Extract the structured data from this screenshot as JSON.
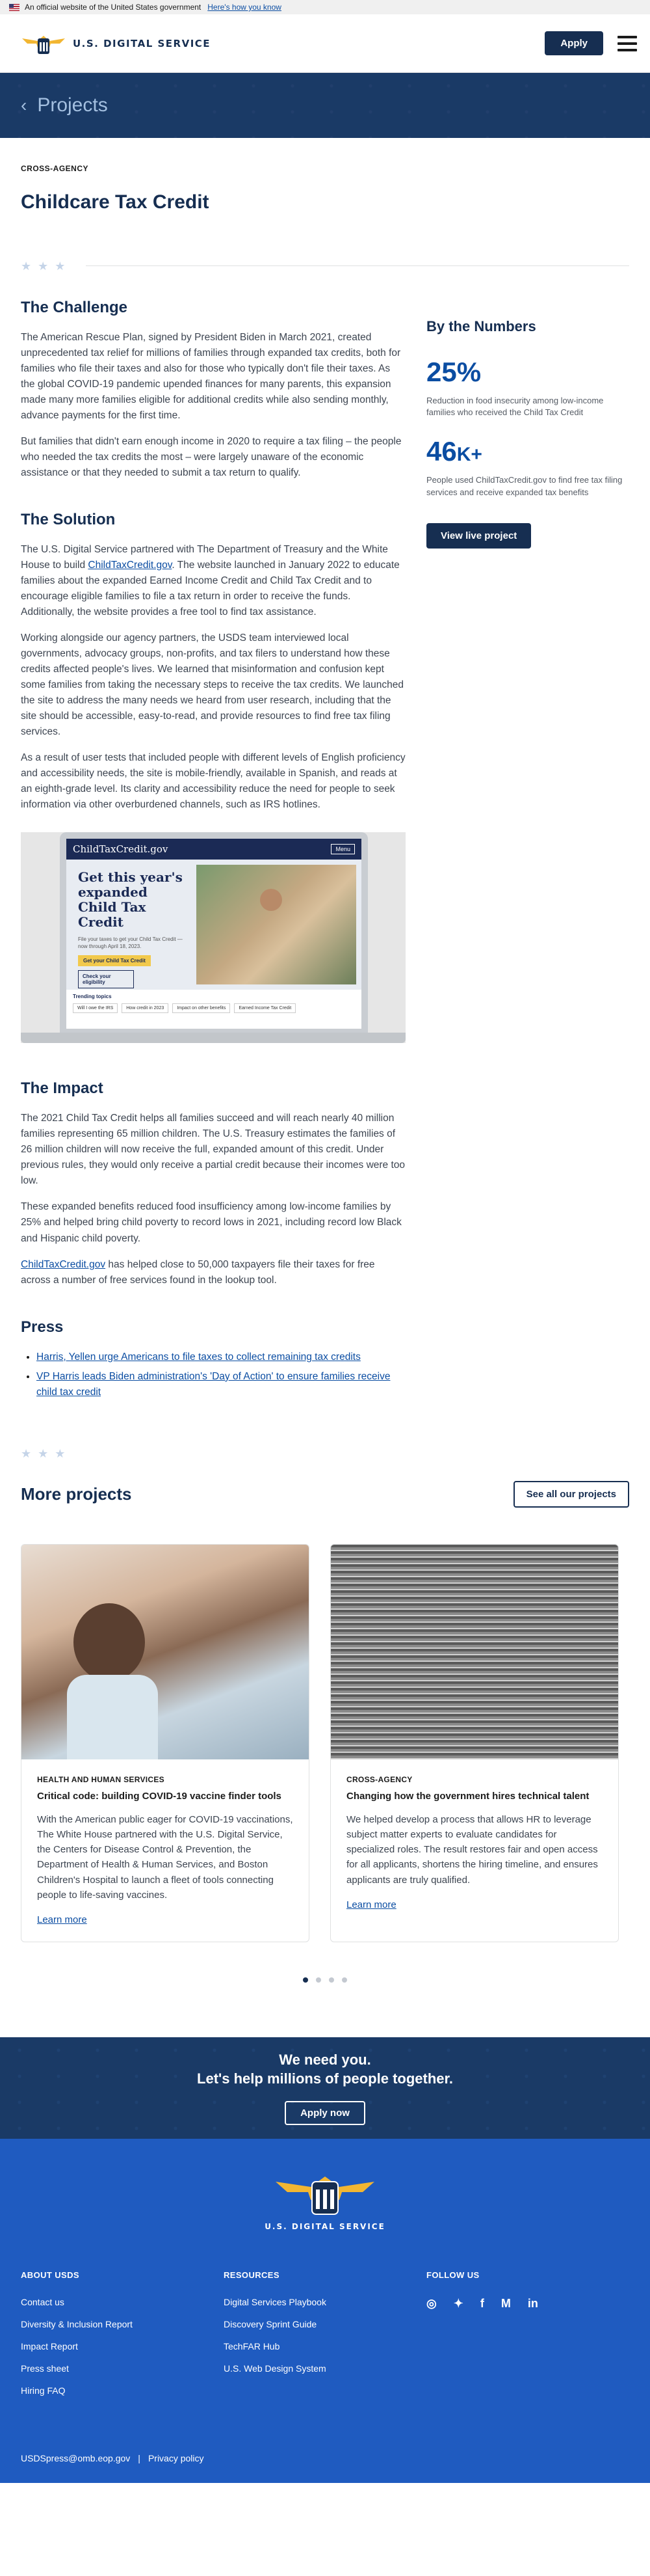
{
  "banner": {
    "text": "An official website of the United States government",
    "link": "Here's how you know"
  },
  "header": {
    "logo_text": "U.S. DIGITAL SERVICE",
    "apply_label": "Apply"
  },
  "hero": {
    "title": "Projects"
  },
  "project": {
    "tag": "CROSS-AGENCY",
    "title": "Childcare Tax Credit"
  },
  "challenge": {
    "heading": "The Challenge",
    "p1": "The American Rescue Plan, signed by President Biden in March 2021, created unprecedented tax relief for millions of families through expanded tax credits, both for families who file their taxes and also for those who typically don't file their taxes. As the global COVID-19 pandemic upended finances for many parents, this expansion made many more families eligible for additional credits while also sending monthly, advance payments for the first time.",
    "p2": "But families that didn't earn enough income in 2020 to require a tax filing – the people who needed the tax credits the most – were largely unaware of the economic assistance or that they needed to submit a tax return to qualify."
  },
  "solution": {
    "heading": "The Solution",
    "p1_before": "The U.S. Digital Service partnered with The Department of Treasury and the White House to build ",
    "p1_link": "ChildTaxCredit.gov",
    "p1_after": ". The website launched in January 2022 to educate families about the expanded Earned Income Credit and Child Tax Credit and to encourage eligible families to file a tax return in order to receive the funds. Additionally, the website provides a free tool to find tax assistance.",
    "p2": "Working alongside our agency partners, the USDS team interviewed local governments, advocacy groups, non-profits, and tax filers to understand how these credits affected people's lives. We learned that misinformation and confusion kept some families from taking the necessary steps to receive the tax credits. We launched the site to address the many needs we heard from user research, including that the site should be accessible, easy-to-read, and provide resources to find free tax filing services.",
    "p3": "As a result of user tests that included people with different levels of English proficiency and accessibility needs, the site is mobile-friendly, available in Spanish, and reads at an eighth-grade level. Its clarity and accessibility reduce the need for people to seek information via other overburdened channels, such as IRS hotlines."
  },
  "screenshot": {
    "logo": "ChildTaxCredit.gov",
    "menu": "Menu",
    "headline": "Get this year's expanded Child Tax Credit",
    "small": "File your taxes to get your Child Tax Credit — now through April 18, 2023.",
    "btn1": "Get your Child Tax Credit",
    "btn2": "Check your eligibility",
    "trending": "Trending topics",
    "chips": [
      "Will I owe the IRS",
      "How credit in 2023",
      "Impact on other benefits",
      "Earned Income Tax Credit"
    ]
  },
  "impact": {
    "heading": "The Impact",
    "p1": "The 2021 Child Tax Credit helps all families succeed and will reach nearly 40 million families representing 65 million children. The U.S. Treasury estimates the families of 26 million children will now receive the full, expanded amount of this credit. Under previous rules, they would only receive a partial credit because their incomes were too low.",
    "p2": "These expanded benefits reduced food insufficiency among low-income families by 25% and helped bring child poverty to record lows in 2021, including record low Black and Hispanic child poverty.",
    "p3_link": "ChildTaxCredit.gov",
    "p3_after": " has helped close to 50,000 taxpayers file their taxes for free across a number of free services found in the lookup tool."
  },
  "press": {
    "heading": "Press",
    "items": [
      "Harris, Yellen urge Americans to file taxes to collect remaining tax credits",
      "VP Harris leads Biden administration's 'Day of Action' to ensure families receive child tax credit"
    ]
  },
  "numbers": {
    "heading": "By the Numbers",
    "stat1_value": "25%",
    "stat1_desc": "Reduction in food insecurity among low-income families who received the Child Tax Credit",
    "stat2_value": "46",
    "stat2_suffix": "K+",
    "stat2_desc": "People used ChildTaxCredit.gov to find free tax filing services and receive expanded tax benefits",
    "button": "View live project"
  },
  "more": {
    "heading": "More projects",
    "see_all": "See all our projects",
    "cards": [
      {
        "tag": "HEALTH AND HUMAN SERVICES",
        "title": "Critical code: building COVID-19 vaccine finder tools",
        "text": "With the American public eager for COVID-19 vaccinations, The White House partnered with the U.S. Digital Service, the Centers for Disease Control & Prevention, the Department of Health & Human Services, and Boston Children's Hospital to launch a fleet of tools connecting people to life-saving vaccines.",
        "link": "Learn more"
      },
      {
        "tag": "CROSS-AGENCY",
        "title": "Changing how the government hires technical talent",
        "text": "We helped develop a process that allows HR to leverage subject matter experts to evaluate candidates for specialized roles. The result restores fair and open access for all applicants, shortens the hiring timeline, and ensures applicants are truly qualified.",
        "link": "Learn more"
      }
    ]
  },
  "cta": {
    "line1": "We need you.",
    "line2": "Let's help millions of people together.",
    "button": "Apply now"
  },
  "footer": {
    "logo_text": "U.S. DIGITAL SERVICE",
    "about_heading": "ABOUT USDS",
    "about_links": [
      "Contact us",
      "Diversity & Inclusion Report",
      "Impact Report",
      "Press sheet",
      "Hiring FAQ"
    ],
    "resources_heading": "RESOURCES",
    "resources_links": [
      "Digital Services Playbook",
      "Discovery Sprint Guide",
      "TechFAR Hub",
      "U.S. Web Design System"
    ],
    "follow_heading": "FOLLOW US",
    "social_icons": [
      "instagram-icon",
      "twitter-icon",
      "facebook-icon",
      "medium-icon",
      "linkedin-icon"
    ],
    "email": "USDSpress@omb.eop.gov",
    "separator": "|",
    "privacy": "Privacy policy"
  }
}
